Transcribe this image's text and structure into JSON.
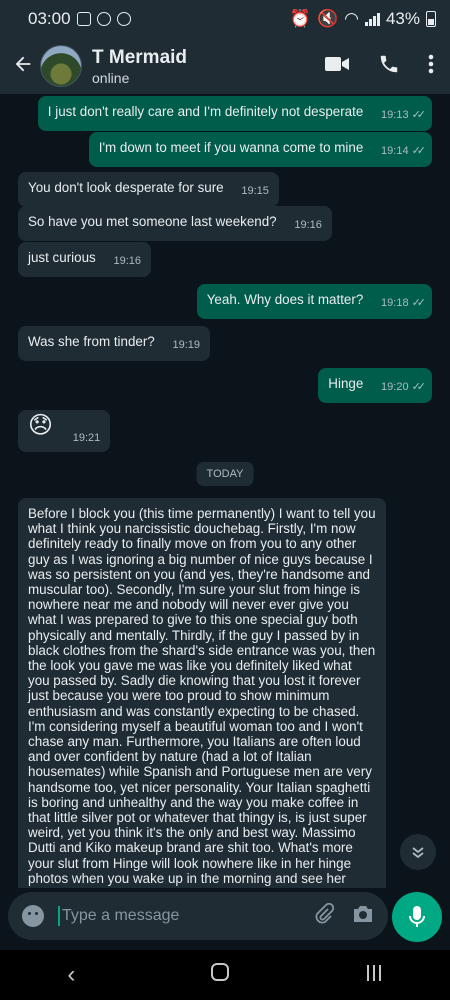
{
  "status_bar": {
    "time": "03:00",
    "battery": "43%"
  },
  "header": {
    "name": "T Mermaid",
    "status": "online"
  },
  "messages": [
    {
      "text": "I just don't really care and I'm definitely not desperate",
      "time": "19:13"
    },
    {
      "text": "I'm down to meet if you wanna come to mine",
      "time": "19:14"
    },
    {
      "text": "You don't look desperate for sure",
      "time": "19:15"
    },
    {
      "text": "So have you met someone last weekend?",
      "time": "19:16"
    },
    {
      "text": "just curious",
      "time": "19:16"
    },
    {
      "text": "Yeah. Why does it matter?",
      "time": "19:18"
    },
    {
      "text": "Was she from tinder?",
      "time": "19:19"
    },
    {
      "text": "Hinge",
      "time": "19:20"
    },
    {
      "text": "😞",
      "time": "19:21"
    }
  ],
  "day_label": "TODAY",
  "long_message": "Before I block you (this time permanently) I want to tell you what I think you narcissistic douchebag. Firstly, I'm now definitely ready to finally move on from you to any other guy as I was ignoring a big number of nice guys because I was so persistent on you (and yes, they're handsome and muscular too). Secondly, I'm sure your slut from hinge is nowhere near me and nobody will never ever give you what I was prepared to give to this one special guy both physically and mentally. Thirdly, if the guy I passed by in black clothes from the shard's side entrance was you, then the look you gave me was like you definitely liked what you passed by. Sadly die knowing that you lost it forever just because you were too proud to show minimum enthusiasm and was constantly expecting to be chased. I'm considering myself a beautiful woman too and I won't chase any man. Furthermore, you Italians are often loud and over confident by nature (had a lot of Italian housemates) while Spanish and Portuguese men are very handsome too, yet nicer personality. Your Italian spaghetti is boring and unhealthy and the way you make coffee in that little silver pot or whatever that thingy is, is just super weird, yet you think it's the only and best way. Massimo Dutti and Kiko makeup brand are shit too. What's more your slut from Hinge will look nowhere like in her hinge photos when you wake up in the morning and see her without a tone of fluid, highlighter, eyeshadows, fake eyelashes and filters. And yes, I'm not poor subhuman Polish waitress or whatever low skilled migrant like I'm often being assumed by your Italian fellows. I've got computer science degree and I'm not interested in rich but uglier guys",
  "input": {
    "placeholder": "Type a message"
  },
  "icons": [
    "back-arrow-icon",
    "video-call-icon",
    "phone-icon",
    "more-vert-icon",
    "emoji-icon",
    "attach-icon",
    "camera-icon",
    "mic-icon",
    "scroll-down-icon"
  ],
  "colors": {
    "outgoing": "#005c4b",
    "incoming": "#1f2c34",
    "accent": "#00a884",
    "background": "#0b141a"
  }
}
